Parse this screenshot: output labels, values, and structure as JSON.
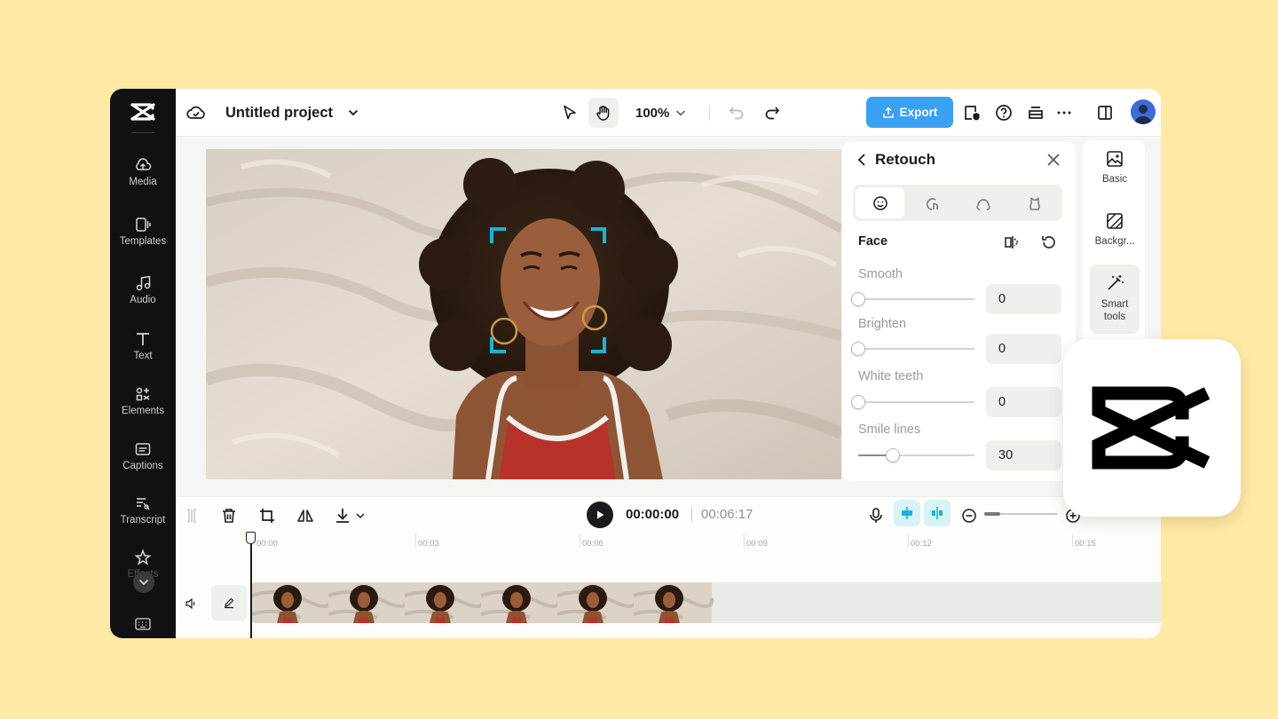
{
  "sidebar": {
    "items": [
      {
        "label": "Media",
        "icon": "cloud-upload-icon"
      },
      {
        "label": "Templates",
        "icon": "templates-icon"
      },
      {
        "label": "Audio",
        "icon": "music-note-icon"
      },
      {
        "label": "Text",
        "icon": "text-t-icon"
      },
      {
        "label": "Elements",
        "icon": "elements-icon"
      },
      {
        "label": "Captions",
        "icon": "captions-icon"
      },
      {
        "label": "Transcript",
        "icon": "transcript-icon"
      },
      {
        "label": "Effects",
        "icon": "effects-star-icon"
      }
    ]
  },
  "topbar": {
    "project_title": "Untitled project",
    "zoom": "100%",
    "export_label": "Export"
  },
  "retouch": {
    "title": "Retouch",
    "section": "Face",
    "sliders": [
      {
        "label": "Smooth",
        "value": "0",
        "fraction": 0
      },
      {
        "label": "Brighten",
        "value": "0",
        "fraction": 0
      },
      {
        "label": "White teeth",
        "value": "0",
        "fraction": 0
      },
      {
        "label": "Smile lines",
        "value": "30",
        "fraction": 0.3
      }
    ]
  },
  "rail": {
    "items": [
      {
        "label": "Basic"
      },
      {
        "label": "Backgr..."
      },
      {
        "label": "Smart tools"
      }
    ]
  },
  "timeline": {
    "current_time": "00:00:00",
    "total_time": "00:06:17",
    "ruler": [
      "00:00",
      "00:03",
      "00:06",
      "00:09",
      "00:12",
      "00:15"
    ]
  },
  "colors": {
    "background": "#ffe9a6",
    "export": "#3aa1f2",
    "face_frame": "#19b4d6"
  }
}
